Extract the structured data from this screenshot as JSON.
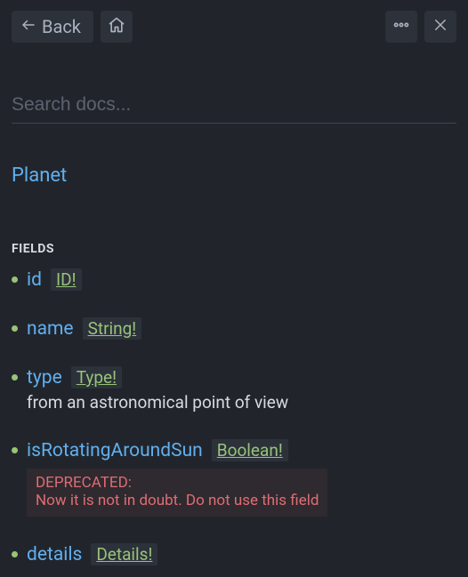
{
  "toolbar": {
    "back_label": "Back"
  },
  "search": {
    "placeholder": "Search docs..."
  },
  "breadcrumb": "Planet",
  "section_label": "FIELDS",
  "fields": [
    {
      "name": "id",
      "type": "ID!"
    },
    {
      "name": "name",
      "type": "String!"
    },
    {
      "name": "type",
      "type": "Type!",
      "description": "from an astronomical point of view"
    },
    {
      "name": "isRotatingAroundSun",
      "type": "Boolean!",
      "deprecated": {
        "title": "DEPRECATED:",
        "message": "Now it is not in doubt. Do not use this field"
      }
    },
    {
      "name": "details",
      "type": "Details!"
    }
  ]
}
